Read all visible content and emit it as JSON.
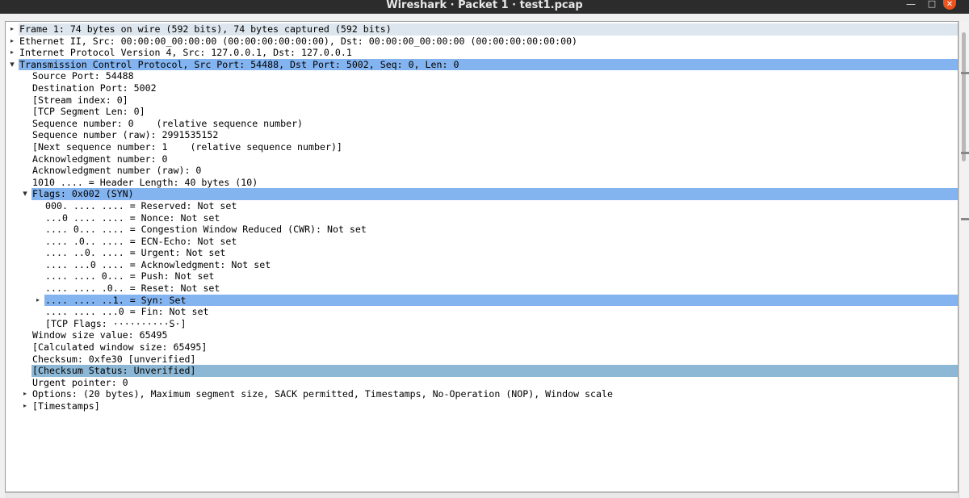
{
  "window": {
    "title": "Wireshark · Packet 1 · test1.pcap",
    "min_glyph": "—",
    "max_glyph": "□",
    "close_glyph": "✕"
  },
  "tree": [
    {
      "text": "Frame 1: 74 bytes on wire (592 bits), 74 bytes captured (592 bits)",
      "expander": "collapsed"
    },
    {
      "text": "Ethernet II, Src: 00:00:00_00:00:00 (00:00:00:00:00:00), Dst: 00:00:00_00:00:00 (00:00:00:00:00:00)",
      "expander": "collapsed"
    },
    {
      "text": "Internet Protocol Version 4, Src: 127.0.0.1, Dst: 127.0.0.1",
      "expander": "collapsed"
    },
    {
      "text": "Transmission Control Protocol, Src Port: 54488, Dst Port: 5002, Seq: 0, Len: 0",
      "expander": "expanded",
      "highlight": "blue"
    },
    {
      "text": "Source Port: 54488"
    },
    {
      "text": "Destination Port: 5002"
    },
    {
      "text": "[Stream index: 0]"
    },
    {
      "text": "[TCP Segment Len: 0]"
    },
    {
      "text": "Sequence number: 0    (relative sequence number)"
    },
    {
      "text": "Sequence number (raw): 2991535152"
    },
    {
      "text": "[Next sequence number: 1    (relative sequence number)]"
    },
    {
      "text": "Acknowledgment number: 0"
    },
    {
      "text": "Acknowledgment number (raw): 0"
    },
    {
      "text": "1010 .... = Header Length: 40 bytes (10)"
    },
    {
      "text": "Flags: 0x002 (SYN)",
      "expander": "expanded",
      "highlight": "blue"
    },
    {
      "text": "000. .... .... = Reserved: Not set"
    },
    {
      "text": "...0 .... .... = Nonce: Not set"
    },
    {
      "text": ".... 0... .... = Congestion Window Reduced (CWR): Not set"
    },
    {
      "text": ".... .0.. .... = ECN-Echo: Not set"
    },
    {
      "text": ".... ..0. .... = Urgent: Not set"
    },
    {
      "text": ".... ...0 .... = Acknowledgment: Not set"
    },
    {
      "text": ".... .... 0... = Push: Not set"
    },
    {
      "text": ".... .... .0.. = Reset: Not set"
    },
    {
      "text": ".... .... ..1. = Syn: Set",
      "expander": "collapsed",
      "highlight": "blue"
    },
    {
      "text": ".... .... ...0 = Fin: Not set"
    },
    {
      "text": "[TCP Flags: ··········S·]"
    },
    {
      "text": "Window size value: 65495"
    },
    {
      "text": "[Calculated window size: 65495]"
    },
    {
      "text": "Checksum: 0xfe30 [unverified]"
    },
    {
      "text": "[Checksum Status: Unverified]",
      "highlight": "gray"
    },
    {
      "text": "Urgent pointer: 0"
    },
    {
      "text": "Options: (20 bytes), Maximum segment size, SACK permitted, Timestamps, No-Operation (NOP), Window scale",
      "expander": "collapsed"
    },
    {
      "text": "[Timestamps]",
      "expander": "collapsed"
    }
  ]
}
